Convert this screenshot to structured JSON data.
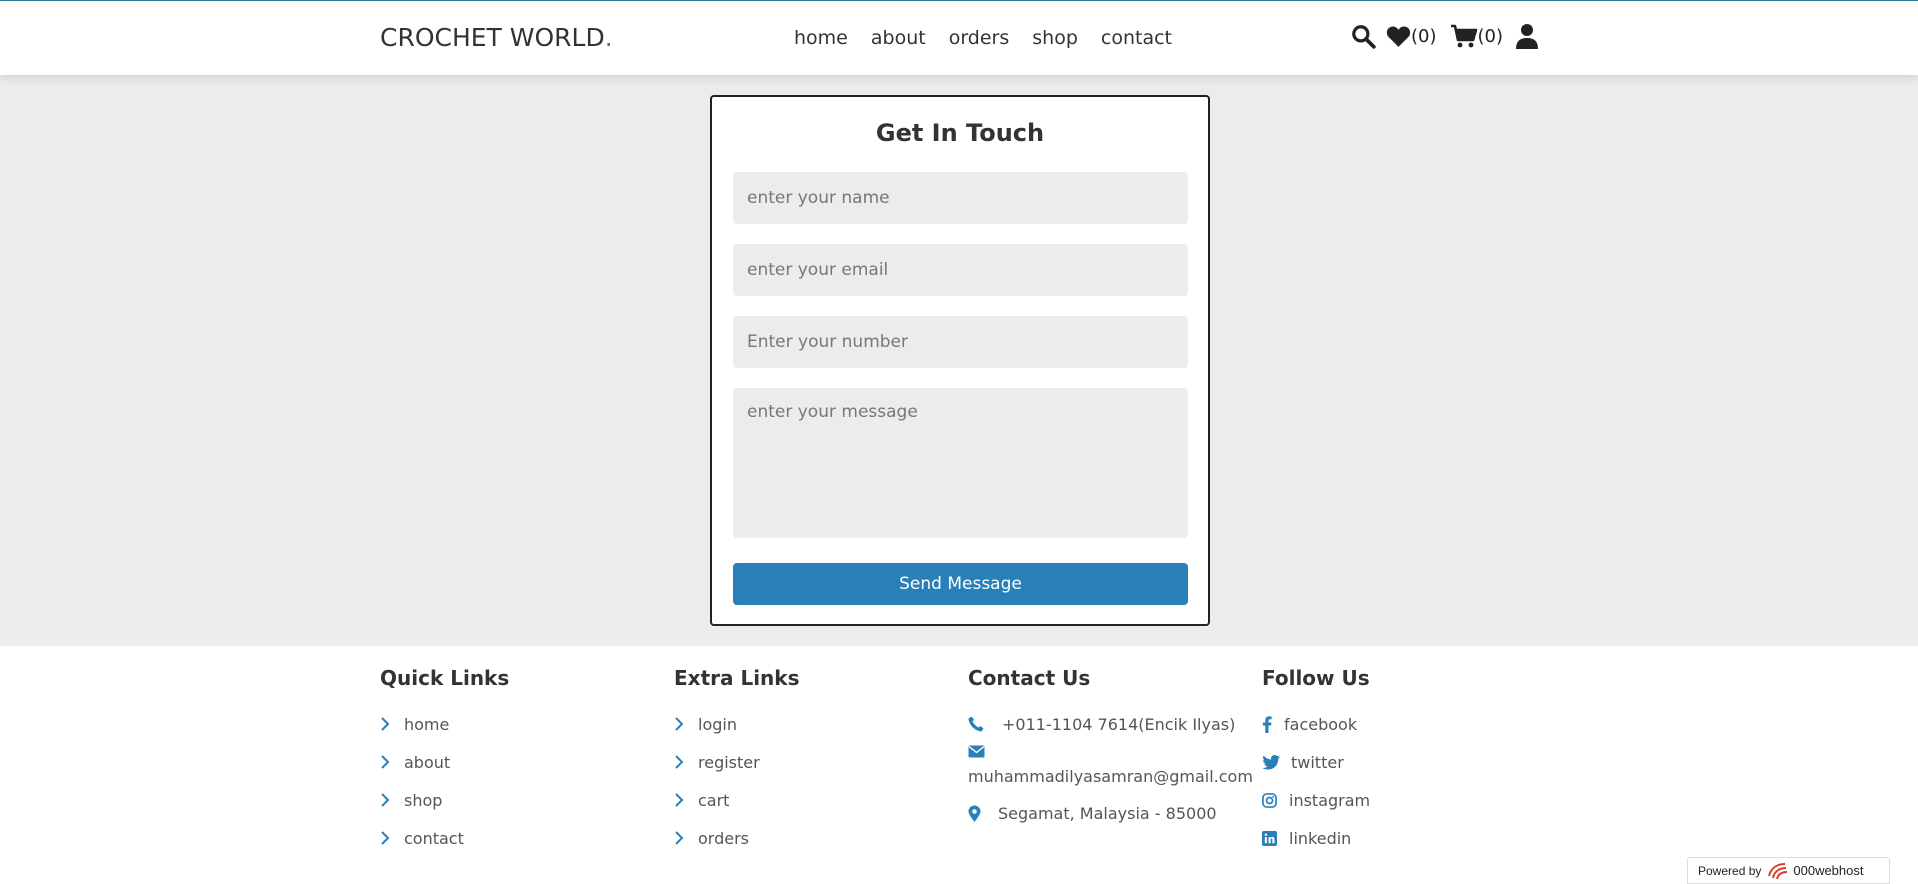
{
  "header": {
    "logo_text": "CROCHET WORLD",
    "logo_dot": ".",
    "nav": [
      "home",
      "about",
      "orders",
      "shop",
      "contact"
    ],
    "wishlist_count": "(0)",
    "cart_count": "(0)"
  },
  "form": {
    "title": "Get In Touch",
    "name_placeholder": "enter your name",
    "email_placeholder": "enter your email",
    "number_placeholder": "Enter your number",
    "message_placeholder": "enter your message",
    "send_label": "Send Message"
  },
  "footer": {
    "quick_links": {
      "title": "Quick Links",
      "items": [
        "home",
        "about",
        "shop",
        "contact"
      ]
    },
    "extra_links": {
      "title": "Extra Links",
      "items": [
        "login",
        "register",
        "cart",
        "orders"
      ]
    },
    "contact": {
      "title": "Contact Us",
      "phone": "+011-1104 7614(Encik Ilyas)",
      "email": "muhammadilyasamran@gmail.com",
      "address": "Segamat, Malaysia - 85000"
    },
    "follow": {
      "title": "Follow Us",
      "items": [
        "facebook",
        "twitter",
        "instagram",
        "linkedin"
      ]
    }
  },
  "powered": {
    "label": "Powered by",
    "brand": "000webhost"
  },
  "colors": {
    "accent": "#2980b9",
    "background": "#ececec",
    "text": "#333333"
  },
  "icons": [
    "search-icon",
    "heart-icon",
    "cart-icon",
    "user-icon",
    "chevron-right-icon",
    "phone-icon",
    "envelope-icon",
    "map-marker-icon",
    "facebook-icon",
    "twitter-icon",
    "instagram-icon",
    "linkedin-icon"
  ]
}
